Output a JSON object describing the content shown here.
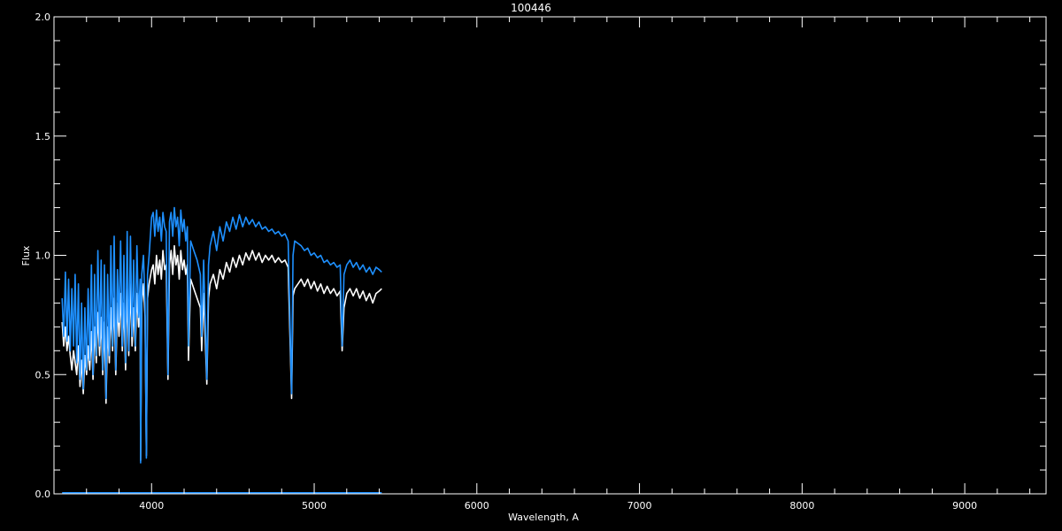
{
  "chart_data": {
    "type": "line",
    "title": "100446",
    "xlabel": "Wavelength, A",
    "ylabel": "Flux",
    "xlim": [
      3400,
      9500
    ],
    "ylim": [
      0.0,
      2.0
    ],
    "x_ticks": [
      4000,
      5000,
      6000,
      7000,
      8000,
      9000
    ],
    "x_tick_labels": [
      "4000",
      "5000",
      "6000",
      "7000",
      "8000",
      "9000"
    ],
    "y_ticks": [
      0.0,
      0.5,
      1.0,
      1.5,
      2.0
    ],
    "y_tick_labels": [
      "0.0",
      "0.5",
      "1.0",
      "1.5",
      "2.0"
    ],
    "x_minor_step": 200,
    "y_minor_step": 0.1,
    "grid": false,
    "colors": {
      "background": "#000000",
      "axes": "#ffffff",
      "series_1": "#ffffff",
      "series_2": "#1e90ff"
    },
    "series": [
      {
        "color": "#ffffff",
        "x": [
          3450,
          3460,
          3470,
          3480,
          3490,
          3500,
          3510,
          3520,
          3530,
          3540,
          3550,
          3560,
          3570,
          3580,
          3590,
          3600,
          3610,
          3620,
          3630,
          3640,
          3650,
          3660,
          3670,
          3680,
          3690,
          3700,
          3710,
          3720,
          3730,
          3740,
          3750,
          3760,
          3770,
          3780,
          3790,
          3800,
          3810,
          3820,
          3830,
          3840,
          3850,
          3860,
          3870,
          3880,
          3890,
          3900,
          3910,
          3920,
          3930,
          3933,
          3940,
          3950,
          3960,
          3968,
          3975,
          3985,
          4000,
          4010,
          4020,
          4030,
          4040,
          4050,
          4060,
          4070,
          4080,
          4090,
          4101,
          4110,
          4120,
          4130,
          4140,
          4150,
          4160,
          4170,
          4180,
          4190,
          4200,
          4210,
          4220,
          4227,
          4240,
          4260,
          4280,
          4300,
          4308,
          4320,
          4340,
          4350,
          4360,
          4380,
          4400,
          4420,
          4440,
          4460,
          4480,
          4500,
          4520,
          4540,
          4560,
          4580,
          4600,
          4620,
          4640,
          4660,
          4680,
          4700,
          4720,
          4740,
          4760,
          4780,
          4800,
          4820,
          4840,
          4861,
          4870,
          4880,
          4900,
          4920,
          4940,
          4960,
          4980,
          5000,
          5020,
          5040,
          5060,
          5080,
          5100,
          5120,
          5140,
          5160,
          5172,
          5183,
          5200,
          5220,
          5240,
          5260,
          5280,
          5300,
          5320,
          5340,
          5360,
          5380,
          5400,
          5415
        ],
        "y": [
          0.72,
          0.62,
          0.7,
          0.6,
          0.66,
          0.58,
          0.52,
          0.6,
          0.55,
          0.5,
          0.62,
          0.45,
          0.56,
          0.42,
          0.58,
          0.5,
          0.62,
          0.52,
          0.68,
          0.48,
          0.7,
          0.55,
          0.76,
          0.58,
          0.74,
          0.5,
          0.72,
          0.38,
          0.7,
          0.55,
          0.78,
          0.6,
          0.82,
          0.5,
          0.8,
          0.66,
          0.84,
          0.6,
          0.8,
          0.52,
          0.86,
          0.58,
          0.88,
          0.62,
          0.78,
          0.6,
          0.84,
          0.7,
          0.78,
          0.14,
          0.8,
          0.88,
          0.74,
          0.16,
          0.82,
          0.88,
          0.94,
          0.96,
          0.88,
          1.0,
          0.92,
          0.98,
          0.9,
          1.02,
          0.94,
          0.96,
          0.48,
          0.96,
          1.02,
          0.92,
          1.04,
          0.96,
          1.0,
          0.9,
          1.02,
          0.94,
          0.98,
          0.92,
          0.96,
          0.56,
          0.9,
          0.86,
          0.82,
          0.78,
          0.6,
          0.84,
          0.46,
          0.82,
          0.88,
          0.92,
          0.86,
          0.94,
          0.9,
          0.97,
          0.93,
          0.99,
          0.95,
          1.0,
          0.96,
          1.01,
          0.98,
          1.02,
          0.98,
          1.01,
          0.97,
          1.0,
          0.98,
          1.0,
          0.97,
          0.99,
          0.97,
          0.98,
          0.95,
          0.4,
          0.83,
          0.86,
          0.88,
          0.9,
          0.87,
          0.9,
          0.86,
          0.89,
          0.85,
          0.88,
          0.84,
          0.87,
          0.84,
          0.86,
          0.83,
          0.85,
          0.6,
          0.78,
          0.84,
          0.86,
          0.83,
          0.86,
          0.82,
          0.85,
          0.81,
          0.84,
          0.8,
          0.84,
          0.85,
          0.86
        ]
      },
      {
        "color": "#1e90ff",
        "x": [
          3450,
          3460,
          3470,
          3480,
          3490,
          3500,
          3510,
          3520,
          3530,
          3540,
          3550,
          3560,
          3570,
          3580,
          3590,
          3600,
          3610,
          3620,
          3630,
          3640,
          3650,
          3660,
          3670,
          3680,
          3690,
          3700,
          3710,
          3720,
          3730,
          3740,
          3750,
          3760,
          3770,
          3780,
          3790,
          3800,
          3810,
          3820,
          3830,
          3840,
          3850,
          3860,
          3870,
          3880,
          3890,
          3900,
          3910,
          3920,
          3930,
          3933,
          3940,
          3950,
          3960,
          3968,
          3975,
          3985,
          4000,
          4010,
          4020,
          4030,
          4040,
          4050,
          4060,
          4070,
          4080,
          4090,
          4101,
          4110,
          4120,
          4130,
          4140,
          4150,
          4160,
          4170,
          4180,
          4190,
          4200,
          4210,
          4220,
          4227,
          4240,
          4260,
          4280,
          4300,
          4308,
          4320,
          4340,
          4350,
          4360,
          4380,
          4400,
          4420,
          4440,
          4460,
          4480,
          4500,
          4520,
          4540,
          4560,
          4580,
          4600,
          4620,
          4640,
          4660,
          4680,
          4700,
          4720,
          4740,
          4760,
          4780,
          4800,
          4820,
          4840,
          4861,
          4870,
          4880,
          4900,
          4920,
          4940,
          4960,
          4980,
          5000,
          5020,
          5040,
          5060,
          5080,
          5100,
          5120,
          5140,
          5160,
          5172,
          5183,
          5200,
          5220,
          5240,
          5260,
          5280,
          5300,
          5320,
          5340,
          5360,
          5380,
          5400,
          5415
        ],
        "y": [
          0.82,
          0.66,
          0.93,
          0.64,
          0.9,
          0.6,
          0.86,
          0.62,
          0.92,
          0.55,
          0.88,
          0.48,
          0.8,
          0.44,
          0.78,
          0.52,
          0.86,
          0.56,
          0.96,
          0.5,
          0.92,
          0.58,
          1.02,
          0.62,
          0.98,
          0.52,
          0.96,
          0.4,
          0.92,
          0.58,
          1.04,
          0.62,
          1.08,
          0.52,
          0.94,
          0.72,
          1.06,
          0.62,
          1.0,
          0.55,
          1.1,
          0.6,
          1.08,
          0.66,
          0.98,
          0.62,
          1.04,
          0.74,
          0.9,
          0.13,
          0.92,
          1.0,
          0.8,
          0.15,
          0.92,
          1.0,
          1.16,
          1.18,
          1.08,
          1.19,
          1.1,
          1.16,
          1.06,
          1.18,
          1.12,
          1.1,
          0.5,
          1.14,
          1.18,
          1.08,
          1.2,
          1.12,
          1.16,
          1.04,
          1.19,
          1.1,
          1.15,
          1.06,
          1.12,
          0.62,
          1.06,
          1.02,
          0.98,
          0.92,
          0.66,
          0.98,
          0.48,
          0.96,
          1.04,
          1.1,
          1.02,
          1.12,
          1.06,
          1.14,
          1.1,
          1.16,
          1.11,
          1.17,
          1.12,
          1.16,
          1.13,
          1.15,
          1.12,
          1.14,
          1.11,
          1.12,
          1.1,
          1.11,
          1.09,
          1.1,
          1.08,
          1.09,
          1.06,
          0.42,
          1.0,
          1.06,
          1.05,
          1.04,
          1.02,
          1.03,
          1.0,
          1.01,
          0.99,
          1.0,
          0.97,
          0.98,
          0.96,
          0.97,
          0.95,
          0.96,
          0.62,
          0.92,
          0.96,
          0.98,
          0.95,
          0.97,
          0.94,
          0.96,
          0.93,
          0.95,
          0.92,
          0.95,
          0.94,
          0.93
        ]
      }
    ]
  }
}
